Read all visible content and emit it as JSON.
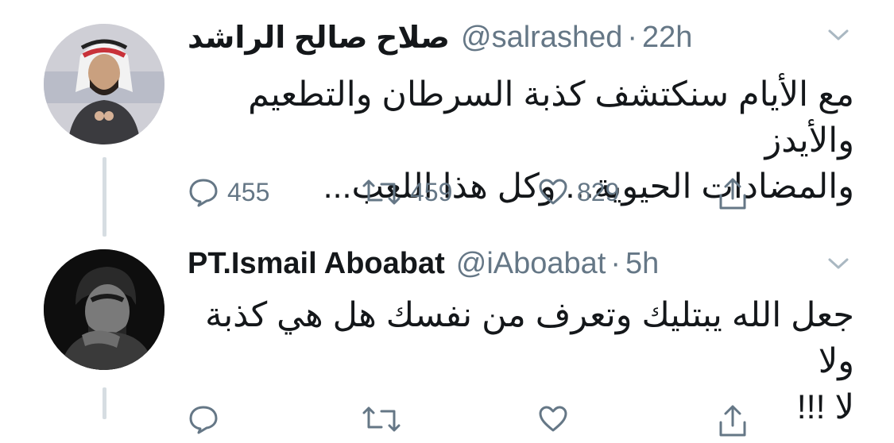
{
  "tweets": [
    {
      "name": "صلاح صالح الراشد",
      "handle": "@salrashed",
      "separator": "·",
      "time": "22h",
      "text": "مع الأيام سنكتشف كذبة السرطان والتطعيم والأيدز\nوالمضادات الحيوية... وكل هذا اللعب...",
      "replies": "455",
      "retweets": "459",
      "likes": "829"
    },
    {
      "name": "PT.Ismail Aboabat",
      "handle": "@iAboabat",
      "separator": "·",
      "time": "5h",
      "text": "جعل الله يبتليك وتعرف من نفسك هل هي كذبة ولا\nلا !!!",
      "replies": "",
      "retweets": "",
      "likes": ""
    }
  ],
  "icons": {
    "reply": "reply-icon",
    "retweet": "retweet-icon",
    "like": "heart-icon",
    "share": "share-icon",
    "caret": "chevron-down-icon"
  },
  "colors": {
    "text": "#14171a",
    "secondary": "#657786",
    "thread_line": "#d6dde2"
  }
}
